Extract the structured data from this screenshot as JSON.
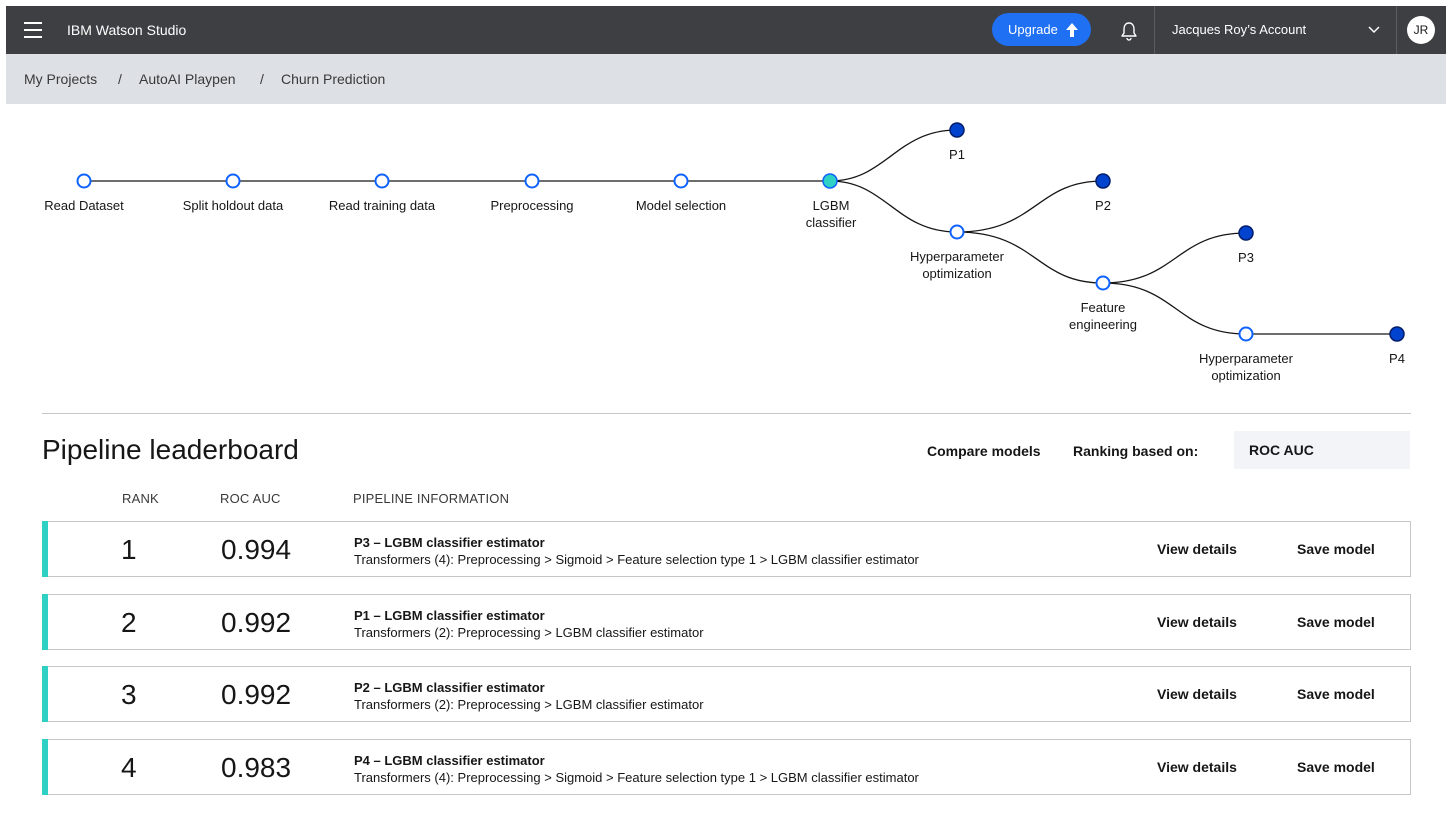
{
  "header": {
    "app_title": "IBM Watson Studio",
    "upgrade_label": "Upgrade",
    "account_label": "Jacques Roy’s Account",
    "avatar_initials": "JR"
  },
  "breadcrumb": {
    "items": [
      "My Projects",
      "AutoAI Playpen",
      "Churn Prediction"
    ],
    "separator": "/"
  },
  "pipeline_diagram": {
    "steps": [
      "Read Dataset",
      "Split holdout data",
      "Read training data",
      "Preprocessing",
      "Model selection"
    ],
    "estimator": [
      "LGBM",
      "classifier"
    ],
    "hpo": [
      "Hyperparameter",
      "optimization"
    ],
    "feature_engineering": [
      "Feature",
      "engineering"
    ],
    "pipelines": [
      "P1",
      "P2",
      "P3",
      "P4"
    ]
  },
  "leaderboard": {
    "title": "Pipeline leaderboard",
    "compare_label": "Compare models",
    "ranking_label": "Ranking based on:",
    "ranking_metric": "ROC AUC",
    "columns": [
      "RANK",
      "ROC AUC",
      "PIPELINE INFORMATION"
    ],
    "rows": [
      {
        "rank": "1",
        "score": "0.994",
        "name": "P3 – LGBM classifier estimator",
        "desc": "Transformers (4): Preprocessing > Sigmoid > Feature selection type 1 > LGBM classifier estimator",
        "view": "View details",
        "save": "Save model"
      },
      {
        "rank": "2",
        "score": "0.992",
        "name": "P1 – LGBM classifier estimator",
        "desc": "Transformers (2): Preprocessing > LGBM classifier estimator",
        "view": "View details",
        "save": "Save model"
      },
      {
        "rank": "3",
        "score": "0.992",
        "name": "P2 – LGBM classifier estimator",
        "desc": "Transformers (2): Preprocessing > LGBM classifier estimator",
        "view": "View details",
        "save": "Save model"
      },
      {
        "rank": "4",
        "score": "0.983",
        "name": "P4 – LGBM classifier estimator",
        "desc": "Transformers (4): Preprocessing > Sigmoid > Feature selection type 1 > LGBM classifier estimator",
        "view": "View details",
        "save": "Save model"
      }
    ]
  },
  "colors": {
    "topbar": "#3d3f42",
    "brand_blue": "#1f70f2",
    "node_outline": "#0f62fe",
    "node_selected": "#2ed1c4",
    "pipeline_node": "#0043ce",
    "row_accent": "#2ed1c4",
    "breadcrumb_bg": "#dde1e6"
  },
  "icons": {
    "menu": "hamburger-menu-icon",
    "upgrade": "arrow-up-icon",
    "notifications": "bell-icon",
    "account_dropdown": "chevron-down-icon"
  }
}
